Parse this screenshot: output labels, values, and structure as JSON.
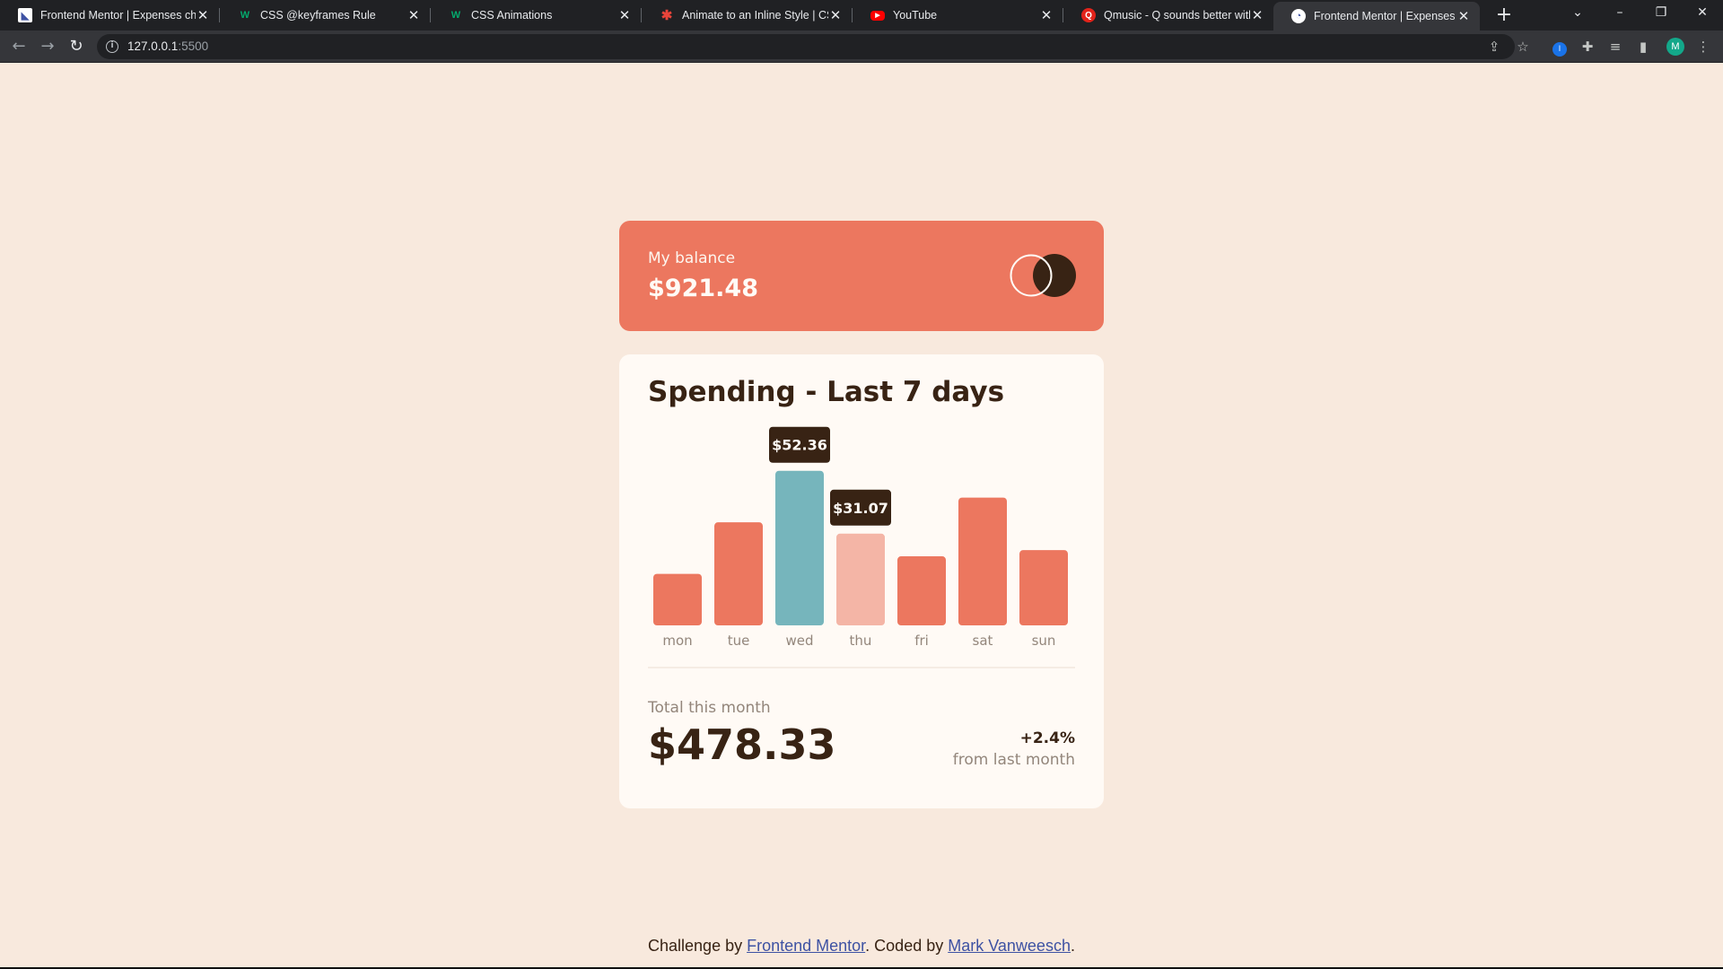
{
  "browser": {
    "tabs": [
      {
        "title": "Frontend Mentor | Expenses chart component",
        "favicon": "frontend-mentor-icon"
      },
      {
        "title": "CSS @keyframes Rule",
        "favicon": "w3schools-icon"
      },
      {
        "title": "CSS Animations",
        "favicon": "w3schools-icon"
      },
      {
        "title": "Animate to an Inline Style | CSS-Tricks",
        "favicon": "css-tricks-icon"
      },
      {
        "title": "YouTube",
        "favicon": "youtube-icon"
      },
      {
        "title": "Qmusic - Q sounds better with you",
        "favicon": "qmusic-icon"
      },
      {
        "title": "Frontend Mentor | Expenses chart component",
        "favicon": "frontend-mentor-icon",
        "active": true
      }
    ],
    "url": {
      "host": "127.0.0.1",
      "port": ":5500"
    },
    "profile_initial": "M"
  },
  "balance": {
    "label": "My balance",
    "value": "$921.48"
  },
  "spending": {
    "title": "Spending - Last 7 days",
    "total_label": "Total this month",
    "total_value": "$478.33",
    "change": "+2.4%",
    "change_label": "from last month"
  },
  "chart_data": {
    "type": "bar",
    "categories": [
      "mon",
      "tue",
      "wed",
      "thu",
      "fri",
      "sat",
      "sun"
    ],
    "values": [
      17.45,
      34.91,
      52.36,
      31.07,
      23.39,
      43.28,
      25.48
    ],
    "tooltips": [
      {
        "category": "wed",
        "label": "$52.36"
      },
      {
        "category": "thu",
        "label": "$31.07"
      }
    ],
    "highlight": "wed",
    "hovered": "thu",
    "colors": {
      "bar": "#ec775f",
      "highlight": "#76b5bc",
      "hover": "#f4b5a6",
      "tooltip_bg": "#382314",
      "tooltip_text": "#fffbf6",
      "label": "#93867b"
    }
  },
  "footer": {
    "prefix": "Challenge by ",
    "link1": "Frontend Mentor",
    "middle": ". Coded by ",
    "link2": "Mark Vanweesch",
    "suffix": "."
  }
}
